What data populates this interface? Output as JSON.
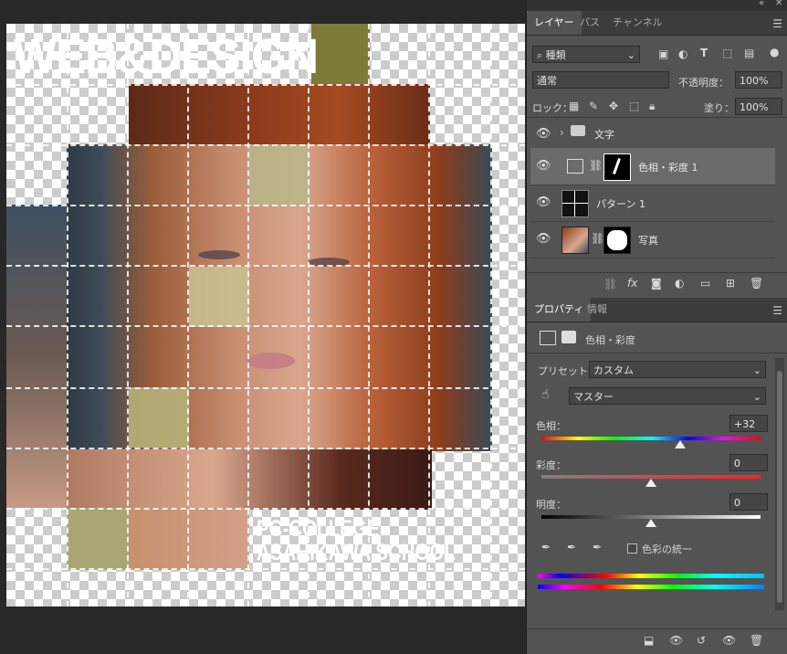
{
  "canvas": {
    "title_text": "WEB&DESIGN",
    "school_line1": "PC-COLLEGE",
    "school_line2": "ASAHIKAWA SCHOOL"
  },
  "window": {
    "collapse_label": "«",
    "close_label": "✕"
  },
  "layers_panel": {
    "tabs": [
      "レイヤー",
      "パス",
      "チャンネル"
    ],
    "filter_kind": "種類",
    "blend_mode": "通常",
    "opacity_label": "不透明度：",
    "opacity_value": "100%",
    "lock_label": "ロック：",
    "fill_label": "塗り：",
    "fill_value": "100%",
    "layers": [
      {
        "name": "文字",
        "type": "group"
      },
      {
        "name": "色相・彩度 1",
        "type": "adjustment"
      },
      {
        "name": "パターン 1",
        "type": "pattern"
      },
      {
        "name": "写真",
        "type": "photo"
      }
    ]
  },
  "properties_panel": {
    "tabs": [
      "プロパティ",
      "情報"
    ],
    "header": "色相・彩度",
    "preset_label": "プリセット：",
    "preset_value": "カスタム",
    "channel_value": "マスター",
    "hue_label": "色相：",
    "hue_value": "+32",
    "saturation_label": "彩度：",
    "saturation_value": "0",
    "lightness_label": "明度：",
    "lightness_value": "0",
    "colorize_label": "色彩の統一",
    "hue_slider_fraction": 0.6333,
    "saturation_slider_fraction": 0.5,
    "lightness_slider_fraction": 0.5
  },
  "icons": [
    "search-icon",
    "image-filter-icon",
    "adjustment-filter-icon",
    "text-filter-icon",
    "shape-filter-icon",
    "smart-filter-icon",
    "eye-icon",
    "folder-icon",
    "link-icon",
    "fx-icon",
    "mask-icon",
    "new-layer-icon",
    "trash-icon",
    "eyedropper-icon",
    "hand-target-icon",
    "menu-icon"
  ]
}
